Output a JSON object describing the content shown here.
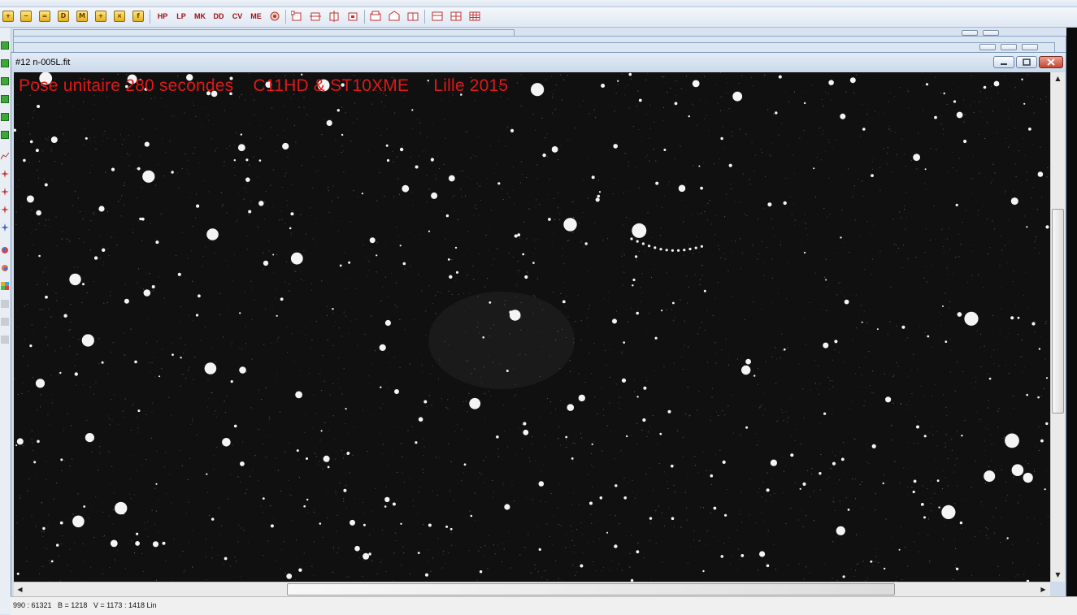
{
  "window": {
    "title": "#12 n-005L.fit",
    "minimize_glyph": "—",
    "maximize_glyph": "□",
    "close_glyph": "✕"
  },
  "toolbar": {
    "square_buttons": [
      "+",
      "−",
      "=",
      "D",
      "M",
      "+",
      "×",
      "f"
    ],
    "text_buttons": [
      "HP",
      "LP",
      "MK",
      "DD",
      "CV",
      "ME"
    ]
  },
  "image": {
    "caption": "Pose unitaire 280 secondes    C11HD & ST10XME     Lille 2015"
  },
  "status": {
    "text": "990 : 61321   B = 1218   V = 1173 : 1418 Lin"
  },
  "scrollbars": {
    "up_arrow": "▲",
    "down_arrow": "▼",
    "left_arrow": "◀",
    "right_arrow": "▶"
  },
  "colors": {
    "caption": "#e01818",
    "image_background": "#101010",
    "accent": "#a01010"
  },
  "icons": [
    "plus-icon",
    "minus-icon",
    "equals-icon",
    "doc-icon",
    "mask-icon",
    "add-icon",
    "multiply-icon",
    "function-icon",
    "frame-icons",
    "grid-icons"
  ]
}
